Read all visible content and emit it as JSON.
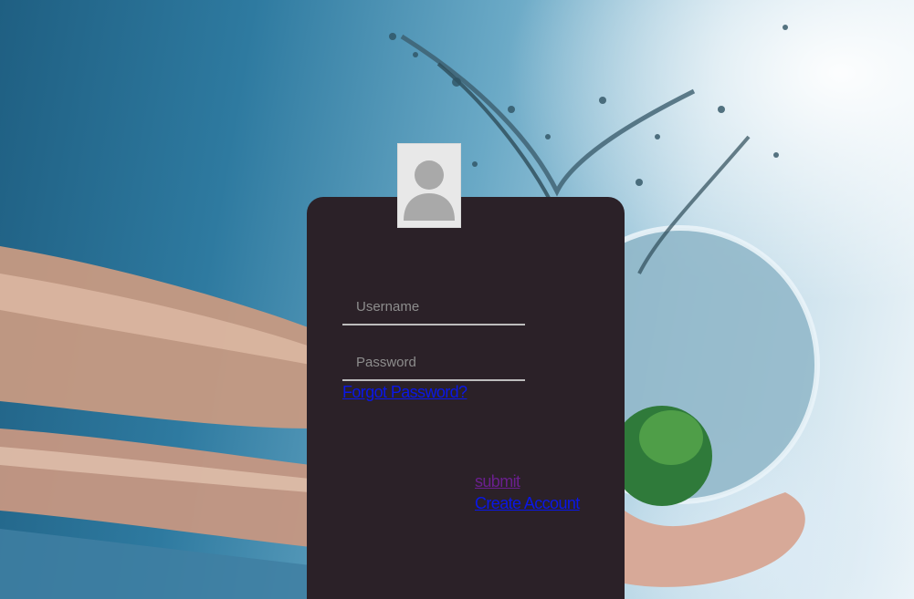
{
  "login": {
    "username_placeholder": "Username",
    "password_placeholder": "Password",
    "forgot_label": "Forgot Password?",
    "submit_label": "submit",
    "create_label": "Create Account"
  },
  "icons": {
    "avatar": "user-silhouette-icon"
  },
  "colors": {
    "card": "#2b2128",
    "link": "#0a17e8",
    "visited_link": "#6a1f8e",
    "field_underline": "#bdbdbd"
  }
}
